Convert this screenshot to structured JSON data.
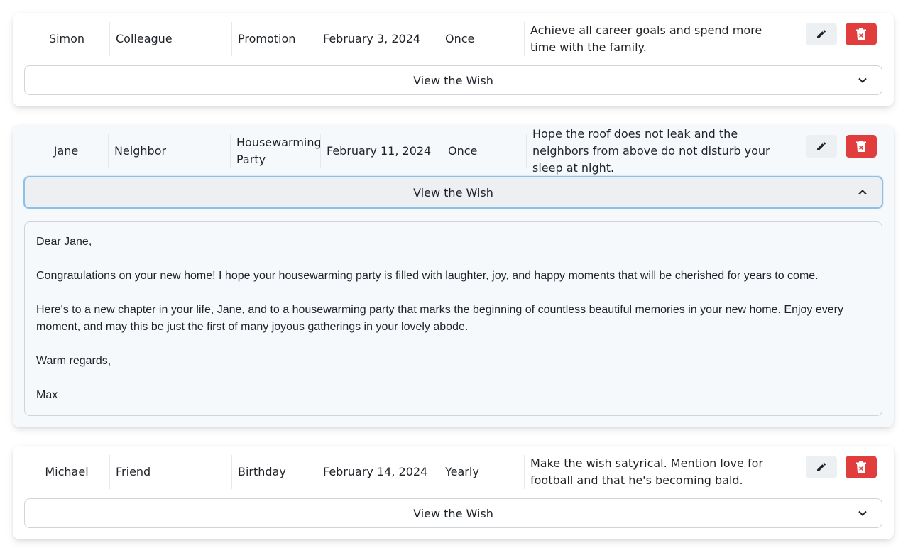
{
  "wishes": [
    {
      "name": "Simon",
      "relation": "Colleague",
      "occasion": "Promotion",
      "date": "February 3, 2024",
      "frequency": "Once",
      "note": "Achieve all career goals and spend more time with the family.",
      "view_label": "View the Wish",
      "expanded": false
    },
    {
      "name": "Jane",
      "relation": "Neighbor",
      "occasion": "Housewarming Party",
      "date": "February 11, 2024",
      "frequency": "Once",
      "note": "Hope the roof does not leak and the neighbors from above do not disturb your sleep at night.",
      "view_label": "View the Wish",
      "expanded": true,
      "wish_text": {
        "greeting": "Dear Jane,",
        "paragraph1": "Congratulations on your new home! I hope your housewarming party is filled with laughter, joy, and happy moments that will be cherished for years to come.",
        "paragraph2": "Here's to a new chapter in your life, Jane, and to a housewarming party that marks the beginning of countless beautiful memories in your new home. Enjoy every moment, and may this be just the first of many joyous gatherings in your lovely abode.",
        "closing": "Warm regards,",
        "signature": "Max"
      }
    },
    {
      "name": "Michael",
      "relation": "Friend",
      "occasion": "Birthday",
      "date": "February 14, 2024",
      "frequency": "Yearly",
      "note": "Make the wish satyrical. Mention love for football and that he's becoming bald.",
      "view_label": "View the Wish",
      "expanded": false
    }
  ],
  "icons": {
    "edit": "pencil-icon",
    "delete": "trash-icon",
    "collapsed": "chevron-down-icon",
    "expanded": "chevron-up-icon"
  },
  "colors": {
    "delete_bg": "#e23d3d",
    "edit_bg": "#edf0f3",
    "focus_border": "#8ebfe6"
  }
}
